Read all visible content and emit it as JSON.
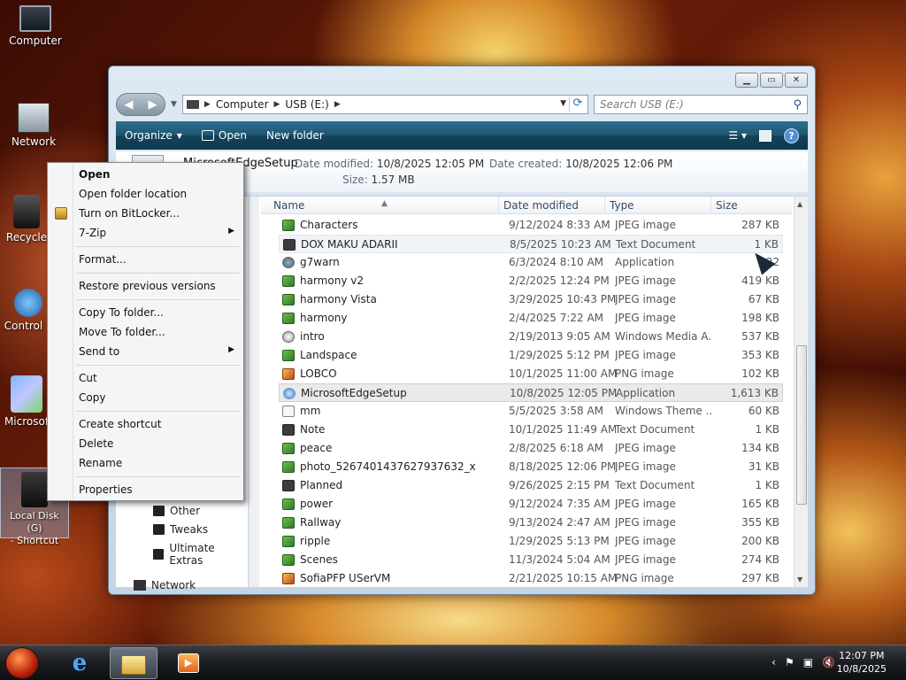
{
  "desktop": {
    "icons": [
      {
        "label": "Computer"
      },
      {
        "label": "Network"
      },
      {
        "label": "Recycle"
      },
      {
        "label": "Control P"
      },
      {
        "label": "Microsof"
      },
      {
        "label": "Local Disk (G)\n- Shortcut"
      }
    ]
  },
  "window": {
    "address": {
      "crumb1": "Computer",
      "crumb2": "USB (E:)"
    },
    "search_placeholder": "Search USB (E:)",
    "toolbar": {
      "organize": "Organize",
      "open": "Open",
      "new_folder": "New folder"
    },
    "details": {
      "name": "MicrosoftEdgeSetup",
      "date_modified_label": "Date modified:",
      "date_modified": "10/8/2025 12:05 PM",
      "date_created_label": "Date created:",
      "date_created": "10/8/2025 12:06 PM",
      "size_label": "Size:",
      "size": "1.57 MB"
    },
    "nav_tree": [
      {
        "label": "Other"
      },
      {
        "label": "Tweaks"
      },
      {
        "label": "Ultimate Extras"
      },
      {
        "label": "Network"
      }
    ],
    "columns": {
      "name": "Name",
      "date": "Date modified",
      "type": "Type",
      "size": "Size"
    },
    "files": [
      {
        "name": "Characters",
        "date": "9/12/2024 8:33 AM",
        "type": "JPEG image",
        "size": "287 KB",
        "icon": "jpeg"
      },
      {
        "name": "DOX MAKU ADARII",
        "date": "8/5/2025 10:23 AM",
        "type": "Text Document",
        "size": "1 KB",
        "icon": "txt"
      },
      {
        "name": "g7warn",
        "date": "6/3/2024 8:10 AM",
        "type": "Application",
        "size": "22",
        "icon": "app"
      },
      {
        "name": "harmony v2",
        "date": "2/2/2025 12:24 PM",
        "type": "JPEG image",
        "size": "419 KB",
        "icon": "jpeg"
      },
      {
        "name": "harmony Vista",
        "date": "3/29/2025 10:43 PM",
        "type": "JPEG image",
        "size": "67 KB",
        "icon": "jpeg"
      },
      {
        "name": "harmony",
        "date": "2/4/2025 7:22 AM",
        "type": "JPEG image",
        "size": "198 KB",
        "icon": "jpeg"
      },
      {
        "name": "intro",
        "date": "2/19/2013 9:05 AM",
        "type": "Windows Media A...",
        "size": "537 KB",
        "icon": "wma"
      },
      {
        "name": "Landspace",
        "date": "1/29/2025 5:12 PM",
        "type": "JPEG image",
        "size": "353 KB",
        "icon": "jpeg"
      },
      {
        "name": "LOBCO",
        "date": "10/1/2025 11:00 AM",
        "type": "PNG image",
        "size": "102 KB",
        "icon": "png"
      },
      {
        "name": "MicrosoftEdgeSetup",
        "date": "10/8/2025 12:05 PM",
        "type": "Application",
        "size": "1,613 KB",
        "icon": "edge"
      },
      {
        "name": "mm",
        "date": "5/5/2025 3:58 AM",
        "type": "Windows Theme ...",
        "size": "60 KB",
        "icon": "theme"
      },
      {
        "name": "Note",
        "date": "10/1/2025 11:49 AM",
        "type": "Text Document",
        "size": "1 KB",
        "icon": "txt"
      },
      {
        "name": "peace",
        "date": "2/8/2025 6:18 AM",
        "type": "JPEG image",
        "size": "134 KB",
        "icon": "jpeg"
      },
      {
        "name": "photo_5267401437627937632_x",
        "date": "8/18/2025 12:06 PM",
        "type": "JPEG image",
        "size": "31 KB",
        "icon": "jpeg"
      },
      {
        "name": "Planned",
        "date": "9/26/2025 2:15 PM",
        "type": "Text Document",
        "size": "1 KB",
        "icon": "txt"
      },
      {
        "name": "power",
        "date": "9/12/2024 7:35 AM",
        "type": "JPEG image",
        "size": "165 KB",
        "icon": "jpeg"
      },
      {
        "name": "Rallway",
        "date": "9/13/2024 2:47 AM",
        "type": "JPEG image",
        "size": "355 KB",
        "icon": "jpeg"
      },
      {
        "name": "ripple",
        "date": "1/29/2025 5:13 PM",
        "type": "JPEG image",
        "size": "200 KB",
        "icon": "jpeg"
      },
      {
        "name": "Scenes",
        "date": "11/3/2024 5:04 AM",
        "type": "JPEG image",
        "size": "274 KB",
        "icon": "jpeg"
      },
      {
        "name": "SofiaPFP USerVM",
        "date": "2/21/2025 10:15 AM",
        "type": "PNG image",
        "size": "297 KB",
        "icon": "png"
      }
    ]
  },
  "context_menu": {
    "open": "Open",
    "open_folder_location": "Open folder location",
    "bitlocker": "Turn on BitLocker...",
    "zip": "7-Zip",
    "format": "Format...",
    "restore": "Restore previous versions",
    "copy_to": "Copy To folder...",
    "move_to": "Move To folder...",
    "send_to": "Send to",
    "cut": "Cut",
    "copy": "Copy",
    "create_shortcut": "Create shortcut",
    "delete": "Delete",
    "rename": "Rename",
    "properties": "Properties"
  },
  "taskbar": {
    "clock_time": "12:07 PM",
    "clock_date": "10/8/2025"
  }
}
